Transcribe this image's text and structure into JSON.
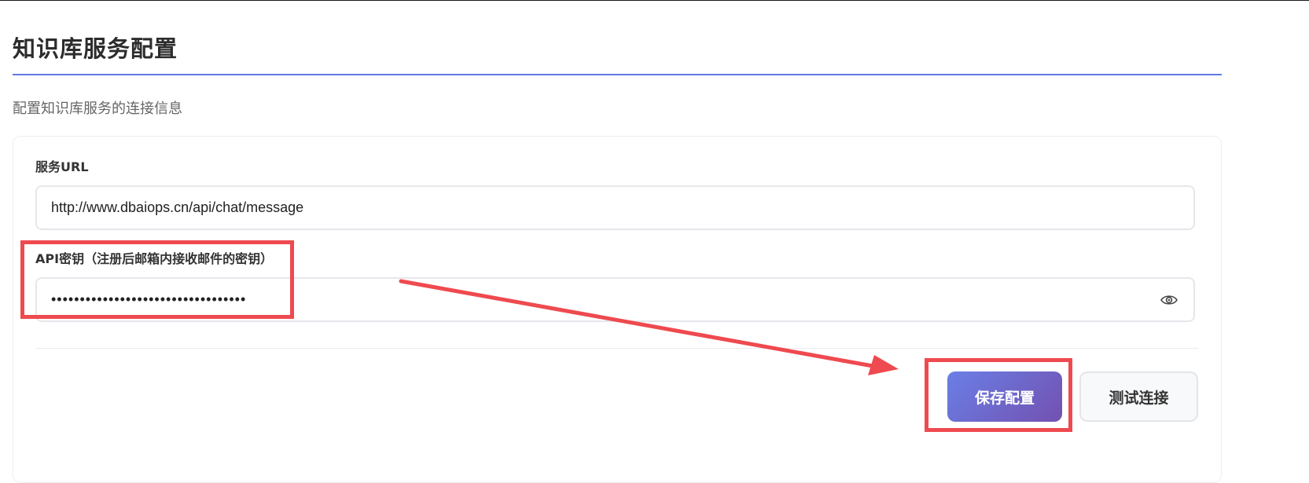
{
  "page": {
    "title": "知识库服务配置",
    "subtitle": "配置知识库服务的连接信息"
  },
  "form": {
    "url_label": "服务URL",
    "url_value": "http://www.dbaiops.cn/api/chat/message",
    "api_key_label": "API密钥（注册后邮箱内接收邮件的密钥）",
    "api_key_value": "••••••••••••••••••••••••••••••••••",
    "toggle_visibility_icon": "eye-icon"
  },
  "actions": {
    "save_label": "保存配置",
    "test_label": "测试连接"
  },
  "colors": {
    "accent": "#6478e4",
    "primary_gradient_start": "#6a7fe6",
    "primary_gradient_end": "#7351b0",
    "annotation": "#ee4a4f"
  }
}
